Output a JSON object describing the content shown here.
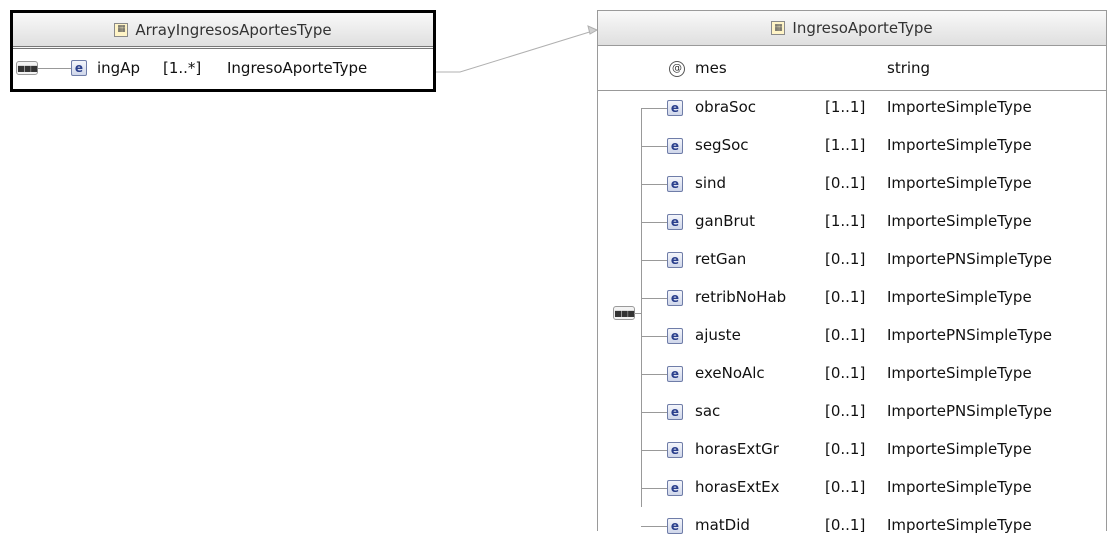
{
  "array_type": {
    "title": "ArrayIngresosAportesType",
    "element": {
      "name": "ingAp",
      "card": "[1..*]",
      "type": "IngresoAporteType"
    }
  },
  "ingreso_type": {
    "title": "IngresoAporteType",
    "attribute": {
      "name": "mes",
      "type": "string"
    },
    "elements": [
      {
        "name": "obraSoc",
        "card": "[1..1]",
        "type": "ImporteSimpleType"
      },
      {
        "name": "segSoc",
        "card": "[1..1]",
        "type": "ImporteSimpleType"
      },
      {
        "name": "sind",
        "card": "[0..1]",
        "type": "ImporteSimpleType"
      },
      {
        "name": "ganBrut",
        "card": "[1..1]",
        "type": "ImporteSimpleType"
      },
      {
        "name": "retGan",
        "card": "[0..1]",
        "type": "ImportePNSimpleType"
      },
      {
        "name": "retribNoHab",
        "card": "[0..1]",
        "type": "ImporteSimpleType"
      },
      {
        "name": "ajuste",
        "card": "[0..1]",
        "type": "ImportePNSimpleType"
      },
      {
        "name": "exeNoAlc",
        "card": "[0..1]",
        "type": "ImporteSimpleType"
      },
      {
        "name": "sac",
        "card": "[0..1]",
        "type": "ImportePNSimpleType"
      },
      {
        "name": "horasExtGr",
        "card": "[0..1]",
        "type": "ImporteSimpleType"
      },
      {
        "name": "horasExtEx",
        "card": "[0..1]",
        "type": "ImporteSimpleType"
      },
      {
        "name": "matDid",
        "card": "[0..1]",
        "type": "ImporteSimpleType"
      }
    ]
  },
  "icons": {
    "complex_type": "complex-type-icon",
    "element": "element-icon",
    "attribute": "attribute-icon",
    "sequence": "sequence-icon"
  },
  "colors": {
    "element_icon_border": "#6f7da8",
    "header_gradient_top": "#f9f9f9",
    "header_gradient_bottom": "#dfdfdf",
    "connector": "#b0b0b0"
  }
}
